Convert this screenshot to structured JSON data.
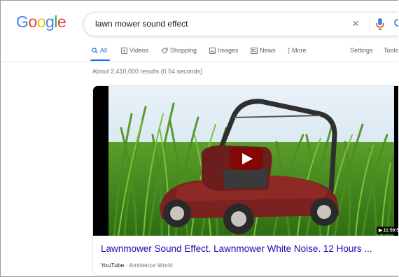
{
  "logo": {
    "letters": [
      "G",
      "o",
      "o",
      "g",
      "l",
      "e"
    ]
  },
  "search": {
    "query": "lawn mower sound effect",
    "clear_symbol": "×"
  },
  "tabs": [
    {
      "label": "All",
      "icon": "search-icon"
    },
    {
      "label": "Videos",
      "icon": "play-box-icon"
    },
    {
      "label": "Shopping",
      "icon": "tag-icon"
    },
    {
      "label": "Images",
      "icon": "image-icon"
    },
    {
      "label": "News",
      "icon": "newspaper-icon"
    },
    {
      "label": "More",
      "icon": "more-vert-icon"
    },
    {
      "label": "Settings"
    },
    {
      "label": "Tools"
    }
  ],
  "result_stats": "About 2,410,000 results (0.54 seconds)",
  "video_result": {
    "duration": "▶ 11:59:5",
    "title": "Lawnmower Sound Effect. Lawnmower White Noise. 12 Hours ...",
    "source_site": "YouTube",
    "separator": " · ",
    "source_channel": "Ambience World"
  },
  "colors": {
    "google_blue": "#4285F4",
    "google_red": "#EA4335",
    "google_yellow": "#FBBC05",
    "google_green": "#34A853",
    "link": "#1a0dab",
    "active_tab": "#1a73e8",
    "mower_red": "#7a2220"
  }
}
